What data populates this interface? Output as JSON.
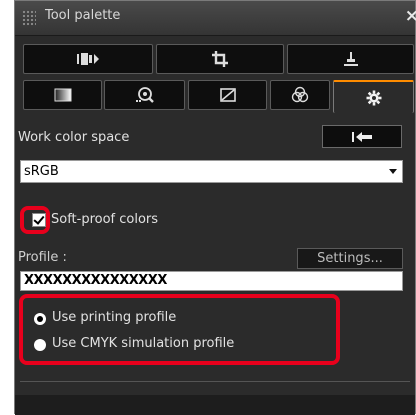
{
  "window": {
    "title": "Tool palette",
    "close_glyph": "×"
  },
  "tool_rows": [
    [
      {
        "name": "tone-curve-tab-icon"
      },
      {
        "name": "crop-tab-icon"
      },
      {
        "name": "dust-delete-tab-icon"
      }
    ],
    [
      {
        "name": "basic-image-adjust-tab-icon"
      },
      {
        "name": "nr-lens-aberration-tab-icon"
      },
      {
        "name": "color-adjust-tab-icon"
      },
      {
        "name": "hsl-tab-icon"
      },
      {
        "name": "settings-tab-icon",
        "active": true
      }
    ]
  ],
  "work_color_space": {
    "label": "Work color space",
    "reset_icon": "reset-arrow-icon",
    "value": "sRGB"
  },
  "soft_proof": {
    "checkbox_label": "Soft-proof colors",
    "checked": true,
    "profile_label": "Profile :",
    "settings_button": "Settings...",
    "profile_value": "XXXXXXXXXXXXXXX",
    "options": [
      {
        "label": "Use printing profile",
        "selected": true
      },
      {
        "label": "Use CMYK simulation profile",
        "selected": false
      }
    ]
  },
  "colors": {
    "highlight": "#e8001c",
    "accent_active_tab": "#ff8c00"
  }
}
